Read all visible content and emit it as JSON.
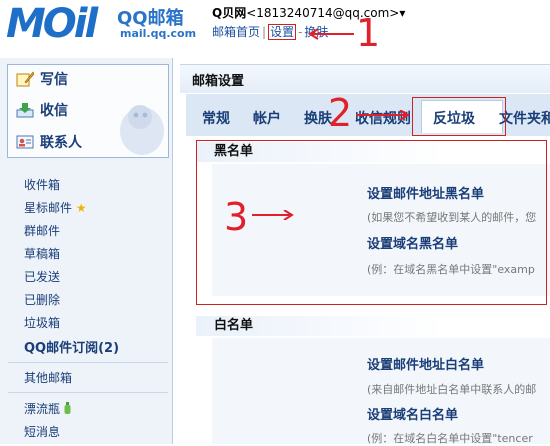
{
  "header": {
    "logo_text": "MOil",
    "logo_brand": "QQ邮箱",
    "logo_domain": "mail.qq.com",
    "user_name": "Q贝网",
    "user_email": "<1813240714@qq.com>",
    "user_dropdown": "▾",
    "nav": [
      "邮箱首页",
      "设置",
      "换肤"
    ]
  },
  "annotations": {
    "n1": "1",
    "n2": "2",
    "n3": "3"
  },
  "sidebar": {
    "actions": [
      "写信",
      "收信",
      "联系人"
    ],
    "folders": [
      "收件箱",
      "星标邮件",
      "群邮件",
      "草稿箱",
      "已发送",
      "已删除",
      "垃圾箱",
      "QQ邮件订阅(2)"
    ],
    "star_icon": "★",
    "other": [
      "其他邮箱"
    ],
    "apps": [
      "漂流瓶",
      "短消息"
    ]
  },
  "main": {
    "title": "邮箱设置",
    "tabs": [
      "常规",
      "帐户",
      "换肤",
      "收信规则",
      "反垃圾",
      "文件夹和"
    ],
    "active_tab": "反垃圾",
    "blacklist": {
      "heading": "黑名单",
      "address_title": "设置邮件地址黑名单",
      "address_desc": "(如果您不希望收到某人的邮件，您",
      "domain_title": "设置域名黑名单",
      "domain_desc": "(例：在域名黑名单中设置\"examp"
    },
    "whitelist": {
      "heading": "白名单",
      "address_title": "设置邮件地址白名单",
      "address_desc": "(来自邮件地址白名单中联系人的邮",
      "domain_title": "设置域名白名单",
      "domain_desc": "(例：在域名白名单中设置\"tencer"
    }
  },
  "colors": {
    "accent": "#1d6fc8",
    "annotation": "#e0202a",
    "nav": "#1a3e78"
  }
}
